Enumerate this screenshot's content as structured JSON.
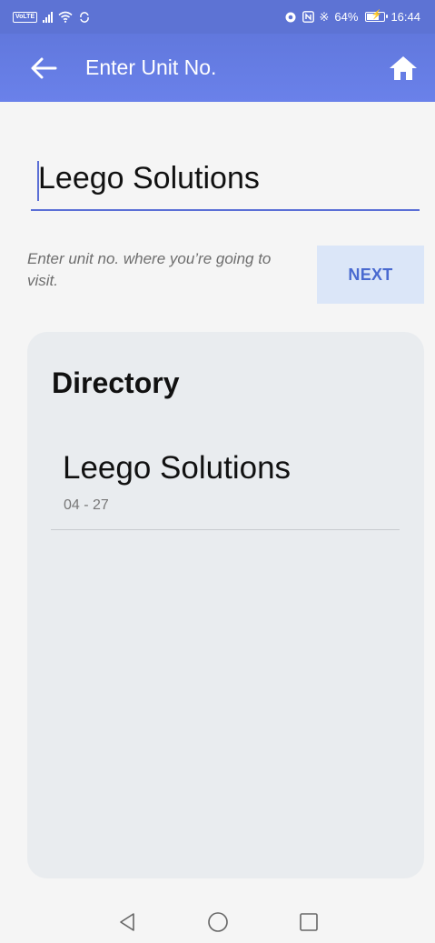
{
  "status_bar": {
    "volte": "VoLTE",
    "battery_percent": "64%",
    "time": "16:44",
    "battery_level": 0.64
  },
  "app_bar": {
    "title": "Enter Unit No.",
    "background": "#6a81ea"
  },
  "form": {
    "unit_value": "Leego Solutions",
    "hint": "Enter unit no. where you’re going to visit.",
    "next_label": "NEXT"
  },
  "directory": {
    "title": "Directory",
    "items": [
      {
        "name": "Leego Solutions",
        "unit": "04 - 27"
      }
    ]
  },
  "icons": {
    "back": "arrow-left-icon",
    "home": "home-icon",
    "nav_back": "triangle-back-icon",
    "nav_home": "circle-home-icon",
    "nav_recents": "square-recents-icon"
  }
}
